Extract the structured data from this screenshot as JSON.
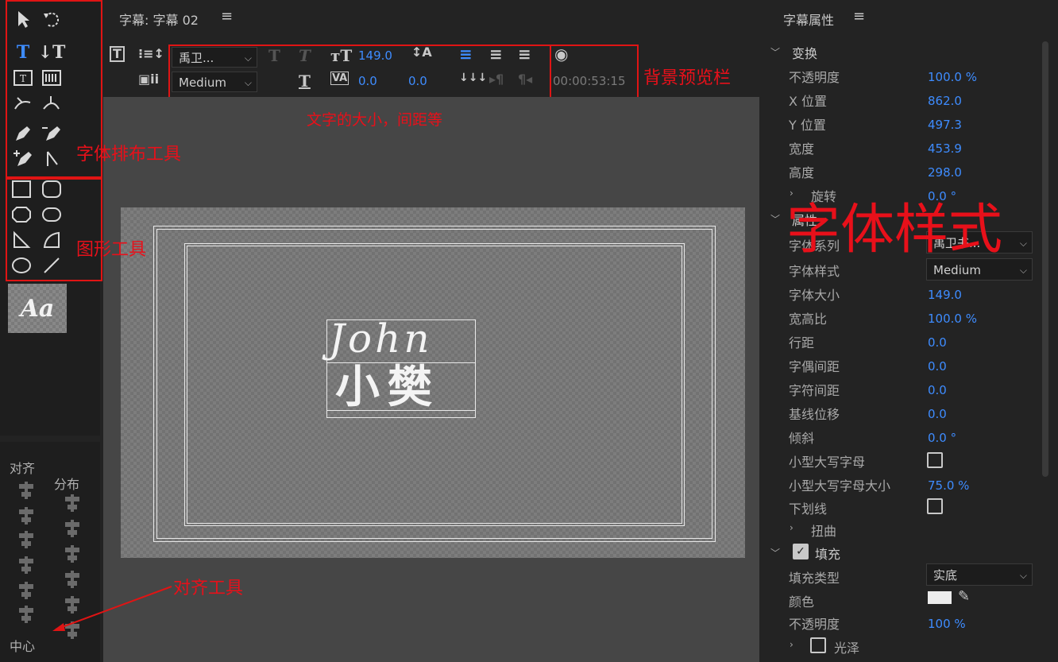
{
  "header": {
    "title": "字幕: 字幕 02",
    "menu_icon": "hamburger-icon"
  },
  "toolbar": {
    "font_family": "禹卫...",
    "font_style": "Medium",
    "font_size": "149.0",
    "kerning": "0.0",
    "leading": "0.0",
    "timecode": "00:00:53:15"
  },
  "properties": {
    "panel_title": "字幕属性",
    "sections": {
      "transform": "变换",
      "attributes": "属性",
      "fill": "填充",
      "sheen": "光泽"
    },
    "rows": {
      "opacity": {
        "label": "不透明度",
        "value": "100.0 %"
      },
      "x_pos": {
        "label": "X 位置",
        "value": "862.0"
      },
      "y_pos": {
        "label": "Y 位置",
        "value": "497.3"
      },
      "width": {
        "label": "宽度",
        "value": "453.9"
      },
      "height": {
        "label": "高度",
        "value": "298.0"
      },
      "rotation": {
        "label": "旋转",
        "value": "0.0 °"
      },
      "font_family": {
        "label": "字体系列",
        "value": "禹卫书..."
      },
      "font_style": {
        "label": "字体样式",
        "value": "Medium"
      },
      "font_size": {
        "label": "字体大小",
        "value": "149.0"
      },
      "aspect": {
        "label": "宽高比",
        "value": "100.0 %"
      },
      "leading": {
        "label": "行距",
        "value": "0.0"
      },
      "kerning": {
        "label": "字偶间距",
        "value": "0.0"
      },
      "tracking": {
        "label": "字符间距",
        "value": "0.0"
      },
      "baseline": {
        "label": "基线位移",
        "value": "0.0"
      },
      "slant": {
        "label": "倾斜",
        "value": "0.0 °"
      },
      "small_caps": {
        "label": "小型大写字母",
        "checked": false
      },
      "small_caps_size": {
        "label": "小型大写字母大小",
        "value": "75.0 %"
      },
      "underline": {
        "label": "下划线",
        "checked": false
      },
      "distort": {
        "label": "扭曲"
      },
      "fill_type": {
        "label": "填充类型",
        "value": "实底"
      },
      "color": {
        "label": "颜色",
        "swatch": "#ececec"
      },
      "fill_opacity": {
        "label": "不透明度",
        "value": "100 %"
      }
    }
  },
  "align_panel": {
    "align_label": "对齐",
    "distribute_label": "分布",
    "center_label": "中心"
  },
  "style_swatch": "Aa",
  "canvas_text": {
    "line1": "John",
    "line2": "小樊"
  },
  "annotations": {
    "typography_tools": "字体排布工具",
    "shape_tools": "图形工具",
    "size_spacing": "文字的大小，间距等",
    "bg_preview": "背景预览栏",
    "font_style": "字体样式",
    "align_tools": "对齐工具"
  },
  "colors": {
    "accent_blue": "#3e8cff",
    "annotation_red": "#e01414"
  }
}
